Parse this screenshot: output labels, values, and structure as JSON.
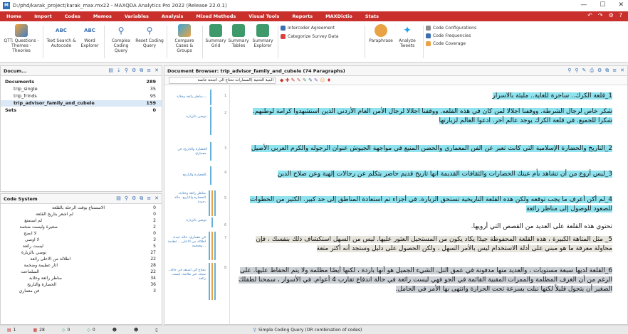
{
  "window": {
    "title": "D:/phd/karak_project/karak_max.mx22 - MAXQDA Analytics Pro 2022 (Release 22.0.1)",
    "controls": [
      "—",
      "☐",
      "✕"
    ]
  },
  "ribbon_tabs": [
    "Home",
    "Import",
    "Codes",
    "Memos",
    "Variables",
    "Analysis",
    "Mixed Methods",
    "Visual Tools",
    "Reports",
    "MAXDictio",
    "Stats"
  ],
  "ribbon": {
    "qtt": "QTT: Questions - Themes - Theories",
    "text_search": "Text Search & Autocode",
    "word_explorer": "Word Explorer",
    "complex_coding": "Complex Coding Query",
    "reset_coding": "Reset Coding Query",
    "compare_cases": "Compare Cases & Groups",
    "summary_grid": "Summary Grid",
    "summary_tables": "Summary Tables",
    "summary_explorer": "Summary Explorer",
    "intercoder": "Intercoder Agreement",
    "categorize": "Categorize Survey Data",
    "paraphrase": "Paraphrase",
    "analyze_tweets": "Analyze Tweets",
    "code_config": "Code Configurations",
    "code_freq": "Code Frequencies",
    "code_coverage": "Code Coverage"
  },
  "doc_panel": {
    "title": "Docum...",
    "rows": [
      {
        "label": "Documents",
        "count": "289"
      },
      {
        "label": "trip_single",
        "count": "35"
      },
      {
        "label": "trip_frinds",
        "count": "95"
      },
      {
        "label": "trip_advisor_family_and_cubele",
        "count": "159"
      },
      {
        "label": "Sets",
        "count": "0"
      }
    ]
  },
  "code_panel": {
    "title": "Code System",
    "rows": [
      {
        "label": "الاستمتاع بوقت الرحلة بالقلعة",
        "count": "0"
      },
      {
        "label": "لم اشعر بتاريخ القلعة",
        "count": "0"
      },
      {
        "label": "لم استمتع",
        "count": "2"
      },
      {
        "label": "صغيرة وليست ضخمة",
        "count": "2"
      },
      {
        "label": "لا انصح",
        "count": "0"
      },
      {
        "label": "لا اوصي",
        "count": "3"
      },
      {
        "label": "ليست رائعة",
        "count": "5"
      },
      {
        "label": "توصي بالزيارة",
        "count": "27"
      },
      {
        "label": "اطلالة من الاعلى رائعة",
        "count": "22"
      },
      {
        "label": "اثار عظيمة وضخمة",
        "count": "28"
      },
      {
        "label": "السلماعت",
        "count": "22"
      },
      {
        "label": "مناظر رائعة وخلابة",
        "count": "34"
      },
      {
        "label": "الحضارة والتاريخ",
        "count": "36"
      },
      {
        "label": "فن معماري",
        "count": "3"
      }
    ]
  },
  "browser": {
    "title": "Document Browser: trip_advisor_family_and_cubele  (74 Paragraphs)",
    "dropdown": "البنية التحتية (المسارات تحتاج الى اجنحة خاصة",
    "paragraphs": [
      {
        "num": "1",
        "text": "1_قلعة الكرك.. ساحرة للغاية.. مليئة بالاسرار",
        "style": "hl"
      },
      {
        "num": "2",
        "text": "شكر خاص لرجال الشرطة. ووقفنا اجلالا لمن كان في هذه القلعه. ووقفنا اجلالا لرجال الأمن العام الأردني الذين استشهدوا كرامة لوطنهم. شكرا للجميع. في قلعة الكرك يوجد عالم آخر. ادعوا العالم لزيارتها",
        "style": "hl"
      },
      {
        "num": "3",
        "text": "2_التاريخ والحضارة الإسلامية التي كانت تعبر عن الفن المعماري والحصن المنيع في مواجهة الجيوش عنوان الرجوله والكرم العربي الأصيل",
        "style": "hl"
      },
      {
        "num": "4",
        "text": "3_ليس أروع من أن تشاهد بأم عينك الحضارات والثقافات القديمة انها تاريخ قديم حاضر يتكلم عن رجالات إلهية وعن صلاح الدين",
        "style": "hl"
      },
      {
        "num": "5",
        "text": "4_لم أكن أعرف ما يجب توقعه ولكن هذه القلعة التاريخية تستحق الزيارة. في أجزاء تم استعادة المناطق إلى حد كبير. الكثير من الخطوات للصعود للوصول إلى مناظر رائعة",
        "style": "hl"
      },
      {
        "num": "6",
        "text": "تحتوي هذه القلعة على العديد من القصص التي أرويها.",
        "style": "none"
      },
      {
        "num": "7",
        "text": "5_ مثل المتاهة الكبيرة ، هذه القلعة المحفوظة جيدًا يكاد يكون من المستحيل العثور عليها. ليس من السهل استكشاف ذلك بنفسك ، فإن محاولة معرفة ما هو مبني على أدلة الاستخدام ليس بالأمر السهل ، ولكن الحصول على دليل وستجد أنه أكثر متعة",
        "style": "hlg"
      },
      {
        "num": "8",
        "text": "6_القلعة لديها سبعة مستويات ، والعديد منها مدفونة في عمق التل. الشيء الجميل هو أنها باردة ، لكنها أيضًا مظلمة ولا يتم الحفاظ عليها. على الرغم من أن الغرف المظلمة والممرات المقبية القائمة في الجو فهي ليست رائعة في حالة اندفاع تقارب 4 أعوام. في الأسوار ، سمحنا لطفلك الصغير أن يتجول قليلاً لكنها نبلت بسرعة تحت الحرارة وانتهى بها الأمر في الحامل.",
        "style": "hlc"
      }
    ],
    "code_labels": [
      "مناظر رائعة وخلابة،...",
      "توصي بالزيارة،",
      "الحضارة والتاريخ، فن معماري،",
      "الحضارة والتاريخ،",
      "مناظر رائعة وخلابة، الحضارة والتاريخ، حالة جيدة،",
      "توصي بالزيارة،",
      "فن معماري، حالة جيدة، اطلالة من الاعلى، ، عظيمة وضخمة...",
      "، تحتاج الى استعد في حالة سيئة، غير ملائمة، ليست رائعة"
    ]
  },
  "status": {
    "items": [
      "1",
      "28",
      "0",
      "0",
      "",
      "",
      "",
      "Simple Coding Query (OR combination of codes)"
    ]
  }
}
